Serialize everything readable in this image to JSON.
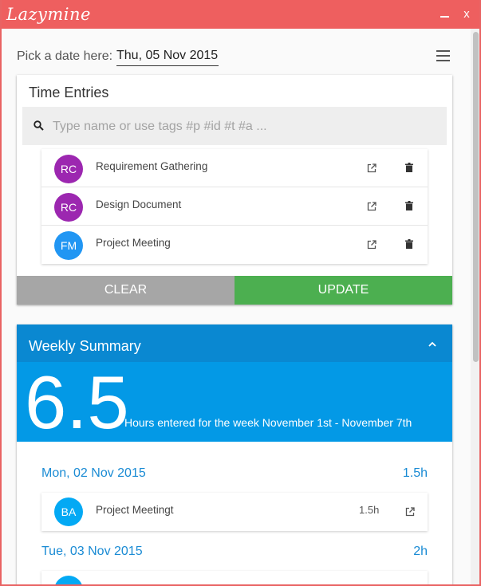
{
  "window": {
    "title": "Lazymine",
    "minimize_label": "_",
    "close_label": "x"
  },
  "date_picker": {
    "label": "Pick a date here:",
    "value": "Thu, 05 Nov 2015"
  },
  "time_entries": {
    "title": "Time Entries",
    "search": {
      "placeholder": "Type name or use tags #p #id #t #a ...",
      "value": ""
    },
    "entries": [
      {
        "initials": "RC",
        "name": "Requirement Gathering",
        "avatar_color": "#9c27b0"
      },
      {
        "initials": "RC",
        "name": "Design Document",
        "avatar_color": "#9c27b0"
      },
      {
        "initials": "FM",
        "name": "Project Meeting",
        "avatar_color": "#2196f3"
      }
    ],
    "clear_label": "CLEAR",
    "update_label": "UPDATE"
  },
  "weekly_summary": {
    "title": "Weekly Summary",
    "total_hours": "6.5",
    "hours_text": "Hours entered for the week November 1st - November 7th",
    "days": [
      {
        "date": "Mon, 02 Nov 2015",
        "total": "1.5h",
        "entries": [
          {
            "initials": "BA",
            "name": "Project Meetingt",
            "hours": "1.5h",
            "avatar_color": "#03a9f4"
          }
        ]
      },
      {
        "date": "Tue, 03 Nov 2015",
        "total": "2h",
        "entries": [
          {
            "initials": "",
            "name": "",
            "hours": "",
            "avatar_color": "#03a9f4"
          }
        ]
      }
    ]
  },
  "colors": {
    "titlebar": "#ee5f5f",
    "accent_blue": "#0399e6",
    "header_blue": "#0a88d1",
    "update_green": "#4caf50",
    "clear_gray": "#a6a6a6"
  }
}
